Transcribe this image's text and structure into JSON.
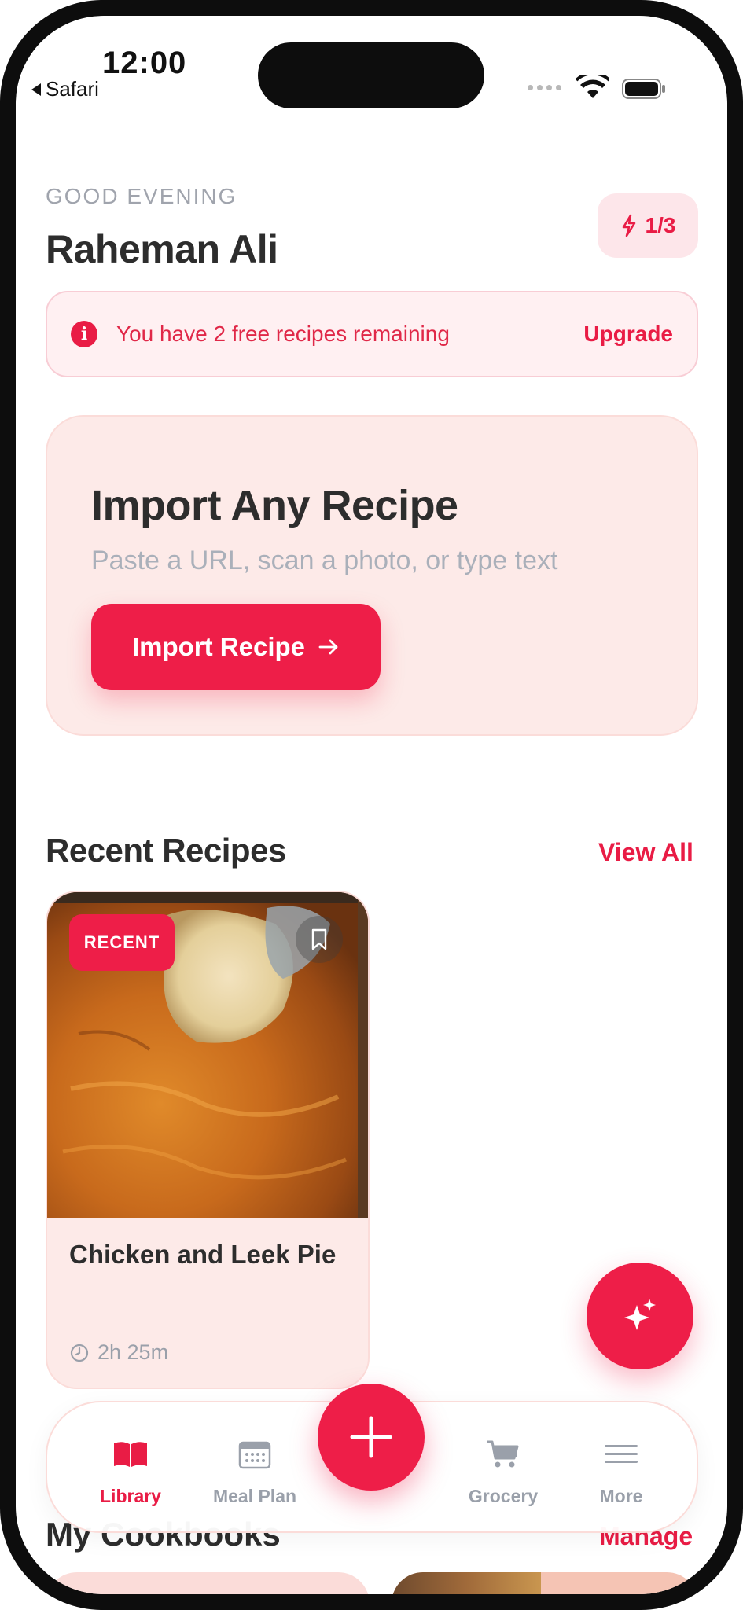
{
  "status_bar": {
    "time": "12:00",
    "back_app": "Safari"
  },
  "header": {
    "greeting": "GOOD EVENING",
    "user_name": "Raheman Ali",
    "credits": "1/3"
  },
  "banner": {
    "message": "You have 2 free recipes remaining",
    "action": "Upgrade"
  },
  "import_card": {
    "title": "Import Any Recipe",
    "subtitle": "Paste a URL, scan a photo, or type text",
    "button_label": "Import Recipe"
  },
  "recent_recipes": {
    "title": "Recent Recipes",
    "view_all": "View All",
    "items": [
      {
        "badge": "RECENT",
        "name": "Chicken and Leek Pie",
        "time": "2h 25m"
      }
    ]
  },
  "cookbooks": {
    "title": "My Cookbooks",
    "action": "Manage"
  },
  "tab_bar": {
    "items": [
      {
        "label": "Library",
        "icon": "book-icon",
        "active": true
      },
      {
        "label": "Meal Plan",
        "icon": "calendar-icon",
        "active": false
      },
      {
        "label": "Grocery",
        "icon": "cart-icon",
        "active": false
      },
      {
        "label": "More",
        "icon": "menu-icon",
        "active": false
      }
    ]
  },
  "colors": {
    "accent": "#ee1e48",
    "accent_text": "#e91c45",
    "card_background": "#fdeae8",
    "banner_background": "#fff0f2",
    "heading_text": "#2d2d2d",
    "muted_text": "#9aa0aa"
  }
}
